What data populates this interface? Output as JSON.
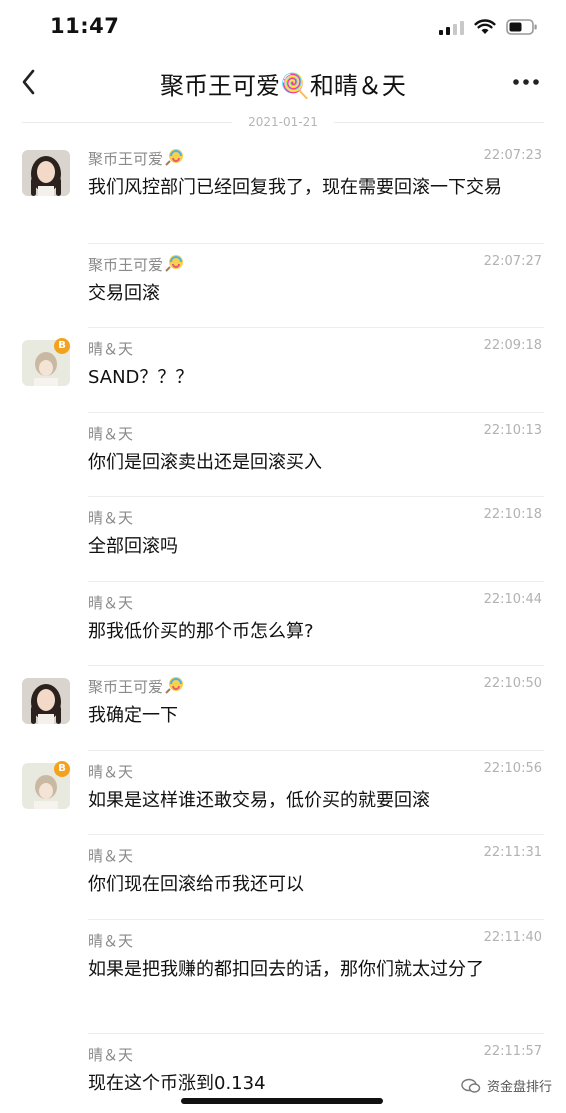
{
  "status_bar": {
    "time": "11:47"
  },
  "nav": {
    "title": "聚币王可爱🍭和晴＆天"
  },
  "date_separator": "2021-01-21",
  "messages": [
    {
      "sender": "聚币王可爱",
      "time": "22:07:23",
      "text": "我们风控部门已经回复我了，现在需要回滚一下交易"
    },
    {
      "sender": "聚币王可爱",
      "time": "22:07:27",
      "text": "交易回滚"
    },
    {
      "sender": "晴＆天",
      "time": "22:09:18",
      "text": "SAND？？？"
    },
    {
      "sender": "晴＆天",
      "time": "22:10:13",
      "text": "你们是回滚卖出还是回滚买入"
    },
    {
      "sender": "晴＆天",
      "time": "22:10:18",
      "text": "全部回滚吗"
    },
    {
      "sender": "晴＆天",
      "time": "22:10:44",
      "text": "那我低价买的那个币怎么算?"
    },
    {
      "sender": "聚币王可爱",
      "time": "22:10:50",
      "text": "我确定一下"
    },
    {
      "sender": "晴＆天",
      "time": "22:10:56",
      "text": "如果是这样谁还敢交易，低价买的就要回滚"
    },
    {
      "sender": "晴＆天",
      "time": "22:11:31",
      "text": "你们现在回滚给币我还可以"
    },
    {
      "sender": "晴＆天",
      "time": "22:11:40",
      "text": "如果是把我赚的都扣回去的话，那你们就太过分了"
    },
    {
      "sender": "晴＆天",
      "time": "22:11:57",
      "text": "现在这个币涨到0.134"
    }
  ],
  "watermark": "资金盘排行",
  "icons": {
    "back": "chevron-left-icon",
    "more": "more-dots-icon",
    "coin": "bitcoin-badge-icon",
    "candy": "lollipop-icon"
  }
}
